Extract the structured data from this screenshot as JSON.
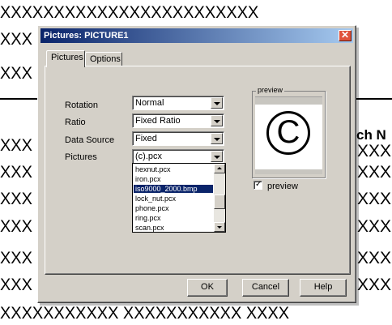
{
  "background": {
    "lines": [
      "XXXXXXXXXXXXXXXXXXXXXXXX",
      "XXX",
      "XXX",
      "XXX",
      "XXX",
      "XXX",
      "XXX",
      "XXX",
      "XXX",
      "XXXXXXXXXXX XXXXXXXXXXX   XXXX"
    ],
    "right_marks": [
      "XXX",
      "XXX",
      "XXX",
      "XXX",
      "XXX",
      "XXX"
    ],
    "heading_fragment": "ch N"
  },
  "dialog": {
    "title": "Pictures: PICTURE1",
    "close_glyph": "✕",
    "tabs": [
      {
        "label": "Pictures",
        "active": true
      },
      {
        "label": "Options",
        "active": false
      }
    ],
    "fields": {
      "rotation": {
        "label": "Rotation",
        "value": "Normal"
      },
      "ratio": {
        "label": "Ratio",
        "value": "Fixed Ratio"
      },
      "data_source": {
        "label": "Data Source",
        "value": "Fixed"
      },
      "pictures": {
        "label": "Pictures",
        "value": "(c).pcx"
      }
    },
    "pictures_list": {
      "items": [
        "hexnut.pcx",
        "iron.pcx",
        "iso9000_2000.bmp",
        "lock_nut.pcx",
        "phone.pcx",
        "ring.pcx",
        "scan.pcx"
      ],
      "selected": "iso9000_2000.bmp"
    },
    "preview": {
      "legend": "preview",
      "symbol": "C",
      "checkbox_label": "preview",
      "checkbox_checked": true,
      "check_glyph": "✓"
    },
    "buttons": {
      "ok": "OK",
      "cancel": "Cancel",
      "help": "Help"
    }
  },
  "colors": {
    "titlebar_start": "#0a246a",
    "titlebar_end": "#a6caf0",
    "dialog_bg": "#d4d0c8",
    "selection": "#0a246a",
    "close_btn": "#e0513a"
  }
}
